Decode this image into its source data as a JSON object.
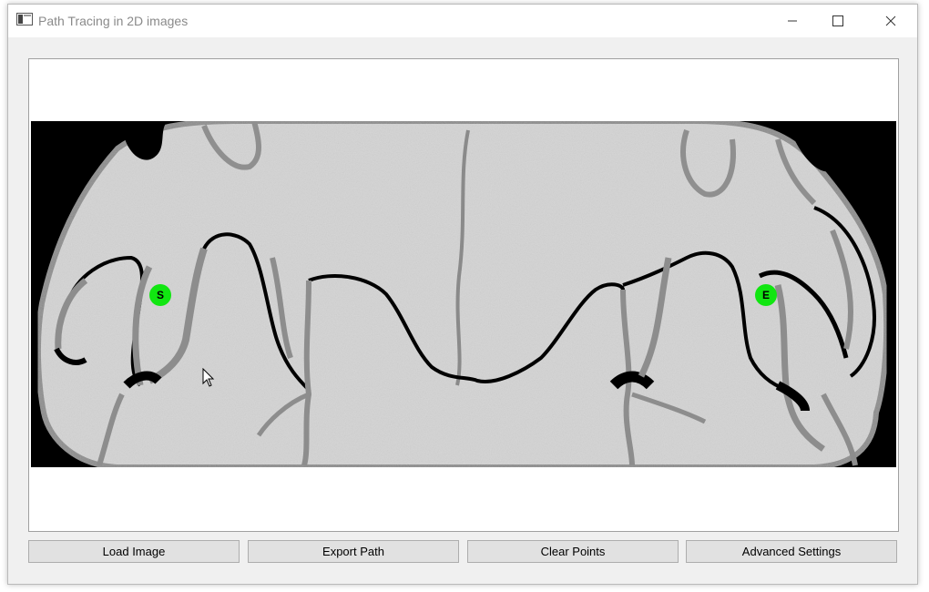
{
  "window": {
    "title": "Path Tracing in 2D images"
  },
  "controls": {
    "minimize": "minimize",
    "maximize": "maximize",
    "close": "close"
  },
  "markers": {
    "start": "S",
    "end": "E"
  },
  "buttons": {
    "load_image": "Load Image",
    "export_path": "Export Path",
    "clear_points": "Clear Points",
    "advanced_settings": "Advanced Settings"
  },
  "colors": {
    "marker": "#11e611",
    "background": "#f0f0f0"
  }
}
